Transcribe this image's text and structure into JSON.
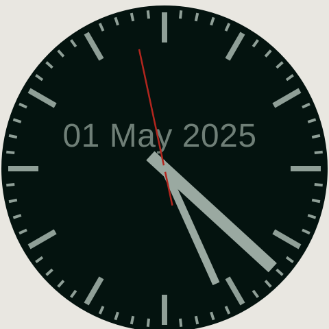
{
  "watch_face": {
    "date": "01 May 2025",
    "time": {
      "hour": 4,
      "minute": 25,
      "second": 58
    },
    "colors": {
      "background": "#e9e7e1",
      "dial": "#04130f",
      "ticks": "#8f9f97",
      "hands": "#9aa9a1",
      "date_text": "#6f7f77",
      "second_hand": "#b3261e"
    },
    "icons": {
      "hour_hand": "hour-hand",
      "minute_hand": "minute-hand",
      "second_hand": "second-hand"
    }
  }
}
